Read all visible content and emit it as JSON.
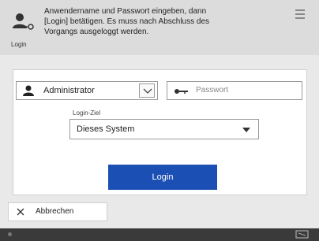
{
  "header": {
    "login_icon_label": "Login",
    "instruction_lines": [
      "Anwendername und Passwort eingeben, dann",
      "[Login] betätigen. Es muss nach Abschluss des",
      "Vorgangs ausgeloggt werden."
    ],
    "menu_icon": "hamburger-menu-icon"
  },
  "form": {
    "user_value": "Administrator",
    "password_placeholder": "Passwort",
    "login_destination_label": "Login-Ziel",
    "login_destination_value": "Dieses System",
    "login_button_label": "Login"
  },
  "footer": {
    "cancel_label": "Abbrechen"
  },
  "colors": {
    "primary_button": "#1c4fb3",
    "header_bg": "#dcdcdc",
    "footer_bg": "#3a3a3a"
  }
}
